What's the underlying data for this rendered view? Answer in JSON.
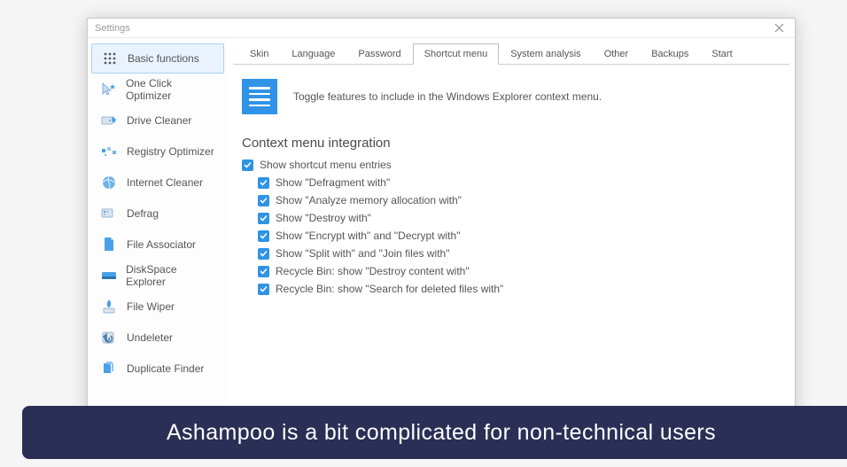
{
  "window": {
    "title": "Settings"
  },
  "sidebar": {
    "items": [
      {
        "label": "Basic functions"
      },
      {
        "label": "One Click Optimizer"
      },
      {
        "label": "Drive Cleaner"
      },
      {
        "label": "Registry Optimizer"
      },
      {
        "label": "Internet Cleaner"
      },
      {
        "label": "Defrag"
      },
      {
        "label": "File Associator"
      },
      {
        "label": "DiskSpace Explorer"
      },
      {
        "label": "File Wiper"
      },
      {
        "label": "Undeleter"
      },
      {
        "label": "Duplicate Finder"
      }
    ]
  },
  "tabs": {
    "items": [
      {
        "label": "Skin"
      },
      {
        "label": "Language"
      },
      {
        "label": "Password"
      },
      {
        "label": "Shortcut menu"
      },
      {
        "label": "System analysis"
      },
      {
        "label": "Other"
      },
      {
        "label": "Backups"
      },
      {
        "label": "Start"
      }
    ]
  },
  "pane": {
    "info": "Toggle features to include in the Windows Explorer context menu.",
    "section_title": "Context menu integration",
    "options": [
      {
        "label": "Show shortcut menu entries",
        "indent": false
      },
      {
        "label": "Show \"Defragment with\"",
        "indent": true
      },
      {
        "label": "Show \"Analyze memory allocation with\"",
        "indent": true
      },
      {
        "label": "Show \"Destroy with\"",
        "indent": true
      },
      {
        "label": "Show \"Encrypt with\" and \"Decrypt with\"",
        "indent": true
      },
      {
        "label": "Show \"Split with\" and \"Join files with\"",
        "indent": true
      },
      {
        "label": "Recycle Bin: show \"Destroy content with\"",
        "indent": true
      },
      {
        "label": "Recycle Bin: show \"Search for deleted files with\"",
        "indent": true
      }
    ]
  },
  "caption": "Ashampoo is a bit complicated for non-technical users"
}
